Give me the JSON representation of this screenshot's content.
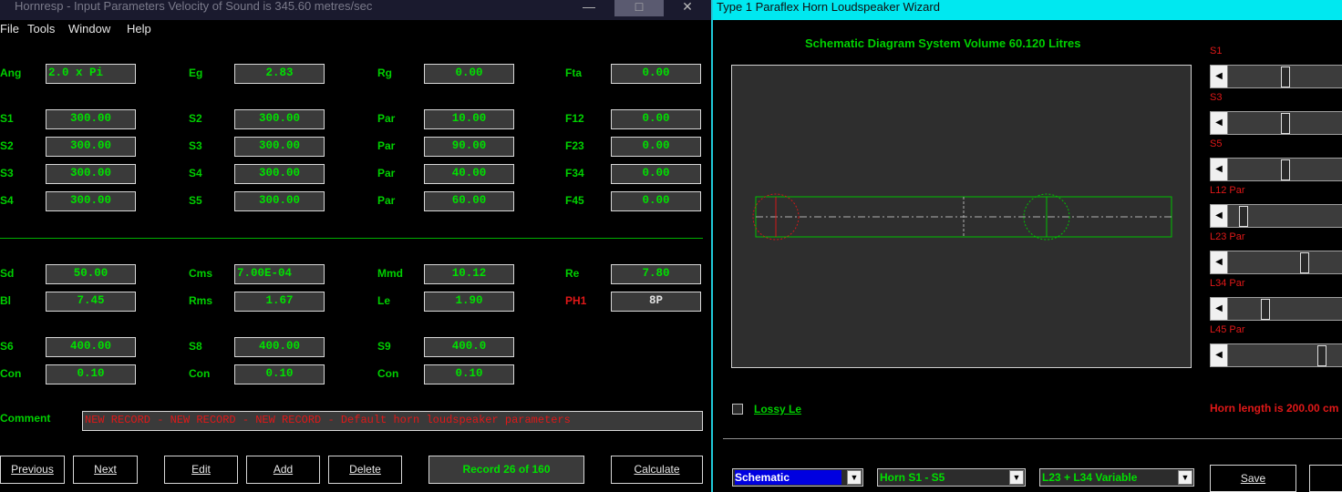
{
  "left_window": {
    "title": "Hornresp - Input Parameters   Velocity of Sound is 345.60 metres/sec",
    "controls": {
      "minimize": "—",
      "maximize": "□",
      "close": "✕"
    },
    "menu": [
      "File",
      "Tools",
      "Window",
      "Help"
    ],
    "rows": [
      {
        "a": {
          "label": "Ang",
          "value": "2.0 x Pi"
        },
        "b": {
          "label": "Eg",
          "value": "2.83"
        },
        "c": {
          "label": "Rg",
          "value": "0.00"
        },
        "d": {
          "label": "Fta",
          "value": "0.00"
        }
      },
      {
        "a": {
          "label": "S1",
          "value": "300.00"
        },
        "b": {
          "label": "S2",
          "value": "300.00"
        },
        "c": {
          "label": "Par",
          "value": "10.00"
        },
        "d": {
          "label": "F12",
          "value": "0.00"
        }
      },
      {
        "a": {
          "label": "S2",
          "value": "300.00"
        },
        "b": {
          "label": "S3",
          "value": "300.00"
        },
        "c": {
          "label": "Par",
          "value": "90.00"
        },
        "d": {
          "label": "F23",
          "value": "0.00"
        }
      },
      {
        "a": {
          "label": "S3",
          "value": "300.00"
        },
        "b": {
          "label": "S4",
          "value": "300.00"
        },
        "c": {
          "label": "Par",
          "value": "40.00"
        },
        "d": {
          "label": "F34",
          "value": "0.00"
        }
      },
      {
        "a": {
          "label": "S4",
          "value": "300.00"
        },
        "b": {
          "label": "S5",
          "value": "300.00"
        },
        "c": {
          "label": "Par",
          "value": "60.00"
        },
        "d": {
          "label": "F45",
          "value": "0.00"
        }
      },
      {
        "a": {
          "label": "Sd",
          "value": "50.00"
        },
        "b": {
          "label": "Cms",
          "value": "7.00E-04"
        },
        "c": {
          "label": "Mmd",
          "value": "10.12"
        },
        "d": {
          "label": "Re",
          "value": "7.80"
        }
      },
      {
        "a": {
          "label": "Bl",
          "value": "7.45"
        },
        "b": {
          "label": "Rms",
          "value": "1.67"
        },
        "c": {
          "label": "Le",
          "value": "1.90"
        },
        "d": {
          "label": "PH1",
          "value": "8P"
        }
      },
      {
        "a": {
          "label": "S6",
          "value": "400.00"
        },
        "b": {
          "label": "S8",
          "value": "400.00"
        },
        "c": {
          "label": "S9",
          "value": "400.0"
        }
      },
      {
        "a": {
          "label": "Con",
          "value": "0.10"
        },
        "b": {
          "label": "Con",
          "value": "0.10"
        },
        "c": {
          "label": "Con",
          "value": "0.10"
        }
      }
    ],
    "comment_label": "Comment",
    "comment": "NEW RECORD - NEW RECORD - NEW RECORD - Default horn loudspeaker parameters",
    "buttons": {
      "previous": "Previous",
      "next": "Next",
      "edit": "Edit",
      "add": "Add",
      "delete": "Delete",
      "record": "Record 26 of 160",
      "calculate": "Calculate"
    }
  },
  "right_window": {
    "title": "Type 1 Paraflex Horn Loudspeaker Wizard",
    "schematic_title": "Schematic Diagram   System Volume 60.120 Litres",
    "sliders": [
      {
        "label": "S1",
        "position": 0.48
      },
      {
        "label": "S3",
        "position": 0.48
      },
      {
        "label": "S5",
        "position": 0.48
      },
      {
        "label": "L12  Par",
        "position": 0.1
      },
      {
        "label": "L23  Par",
        "position": 0.66
      },
      {
        "label": "L34  Par",
        "position": 0.3
      },
      {
        "label": "L45  Par",
        "position": 0.82
      }
    ],
    "lossy_le": "Lossy Le",
    "horn_length": "Horn length is 200.00 cm",
    "dropdowns": [
      "Schematic",
      "Horn S1 - S5",
      "L23 + L34 Variable"
    ],
    "save": "Save",
    "colors": {
      "accent_green": "#00d000",
      "alert_red": "#e01818",
      "title_cyan": "#00e8f0"
    }
  }
}
